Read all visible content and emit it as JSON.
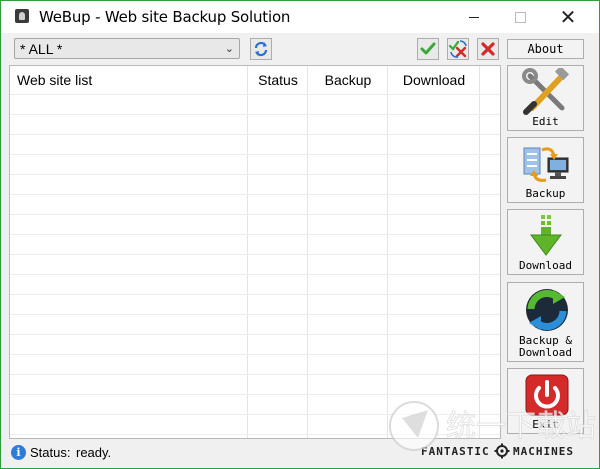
{
  "window": {
    "title": "WeBup - Web site Backup Solution",
    "accent": "#2f9e3a"
  },
  "toolbar": {
    "filter_value": "* ALL *",
    "refresh_icon": "refresh-icon",
    "check_icon": "check-icon",
    "check_x_icon": "check-x-icon",
    "delete_icon": "delete-icon",
    "about_label": "About"
  },
  "grid": {
    "columns": [
      "Web site list",
      "Status",
      "Backup",
      "Download"
    ],
    "rows": []
  },
  "side_buttons": {
    "edit": "Edit",
    "backup": "Backup",
    "download": "Download",
    "backup_download_line1": "Backup &",
    "backup_download_line2": "Download",
    "exit": "Exit"
  },
  "status": {
    "label": "Status:",
    "value": "ready.",
    "brand_left": "FANTASTIC",
    "brand_right": "MACHINES"
  },
  "watermark": {
    "text": "统一下载站"
  }
}
